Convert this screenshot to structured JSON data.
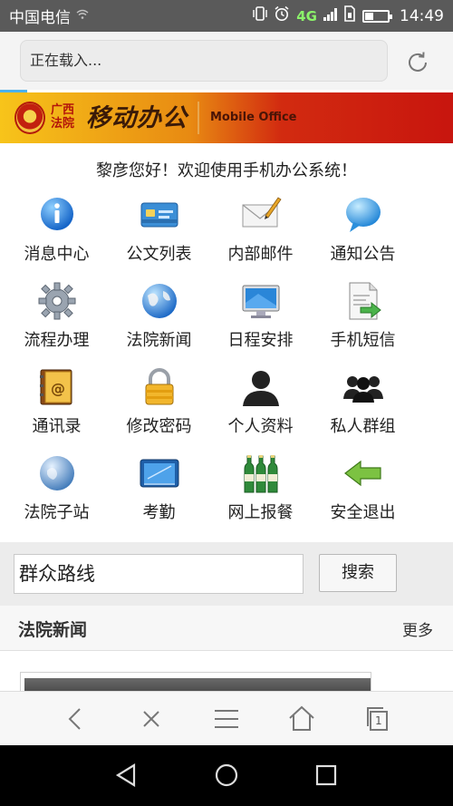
{
  "status_bar": {
    "carrier": "中国电信",
    "network_label": "4G",
    "time": "14:49",
    "icons": [
      "wifi-question-icon",
      "vibrate-icon",
      "alarm-icon",
      "signal-icon",
      "sim-icon",
      "battery-icon"
    ],
    "text_color": "#ffffff",
    "bg_color": "#5a5a5a",
    "network_color": "#8bf36a"
  },
  "browser": {
    "address_text": "正在载入...",
    "reload_icon": "reload-icon",
    "progress_color": "#4ab1f0"
  },
  "banner": {
    "court_name": "广西\n法院",
    "title": "移动办公",
    "subtitle": "Mobile Office"
  },
  "greeting": "黎彦您好！欢迎使用手机办公系统！",
  "menu": [
    {
      "label": "消息中心",
      "icon": "info-icon"
    },
    {
      "label": "公文列表",
      "icon": "card-icon"
    },
    {
      "label": "内部邮件",
      "icon": "mail-icon"
    },
    {
      "label": "通知公告",
      "icon": "speech-bubble-icon"
    },
    {
      "label": "流程办理",
      "icon": "gear-icon"
    },
    {
      "label": "法院新闻",
      "icon": "globe-icon"
    },
    {
      "label": "日程安排",
      "icon": "monitor-icon"
    },
    {
      "label": "手机短信",
      "icon": "document-arrow-icon"
    },
    {
      "label": "通讯录",
      "icon": "address-book-icon"
    },
    {
      "label": "修改密码",
      "icon": "lock-icon"
    },
    {
      "label": "个人资料",
      "icon": "user-icon"
    },
    {
      "label": "私人群组",
      "icon": "users-group-icon"
    },
    {
      "label": "法院子站",
      "icon": "sphere-icon"
    },
    {
      "label": "考勤",
      "icon": "terminal-icon"
    },
    {
      "label": "网上报餐",
      "icon": "bottles-icon"
    },
    {
      "label": "安全退出",
      "icon": "arrow-left-icon"
    }
  ],
  "search": {
    "value": "群众路线",
    "button": "搜索"
  },
  "news": {
    "title": "法院新闻",
    "more": "更多"
  },
  "toolbar": [
    "back-icon",
    "close-icon",
    "menu-icon",
    "home-icon",
    "tabs-icon"
  ],
  "tabs_count": "1",
  "navbar": [
    "nav-back-icon",
    "nav-home-icon",
    "nav-recent-icon"
  ]
}
